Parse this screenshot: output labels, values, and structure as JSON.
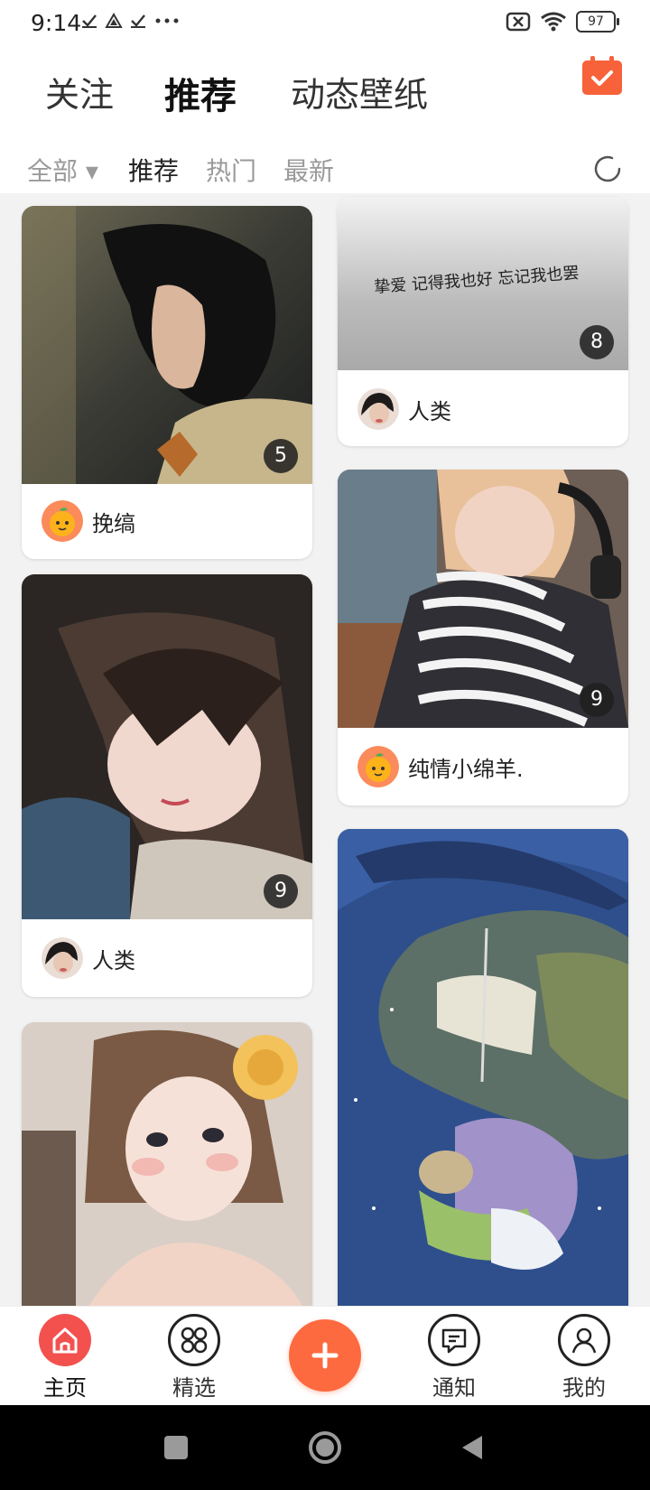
{
  "status": {
    "time": "9:14",
    "battery": "97"
  },
  "top_tabs": [
    {
      "label": "关注"
    },
    {
      "label": "推荐"
    },
    {
      "label": "动态壁纸"
    }
  ],
  "filters": [
    {
      "label": "全部 ▾"
    },
    {
      "label": "推荐"
    },
    {
      "label": "热门"
    },
    {
      "label": "最新"
    }
  ],
  "feed": {
    "cards": [
      {
        "count": "5",
        "author": "挽缟",
        "avatar": "orange-fruit-avatar"
      },
      {
        "caption": "挚爱 记得我也好 忘记我也罢",
        "count": "8",
        "author": "人类",
        "avatar": "portrait-avatar"
      },
      {
        "count": "9",
        "author": "人类",
        "avatar": "portrait-avatar"
      },
      {
        "count": "9",
        "author": "纯情小绵羊.",
        "avatar": "orange-fruit-avatar"
      },
      {
        "count": ""
      },
      {
        "count": ""
      }
    ]
  },
  "bottom_nav": [
    {
      "label": "主页"
    },
    {
      "label": "精选"
    },
    {
      "label": "通知"
    },
    {
      "label": "我的"
    }
  ],
  "colors": {
    "accent": "#fd6a3f",
    "home_active": "#f3514e",
    "calendar": "#f7623a"
  }
}
